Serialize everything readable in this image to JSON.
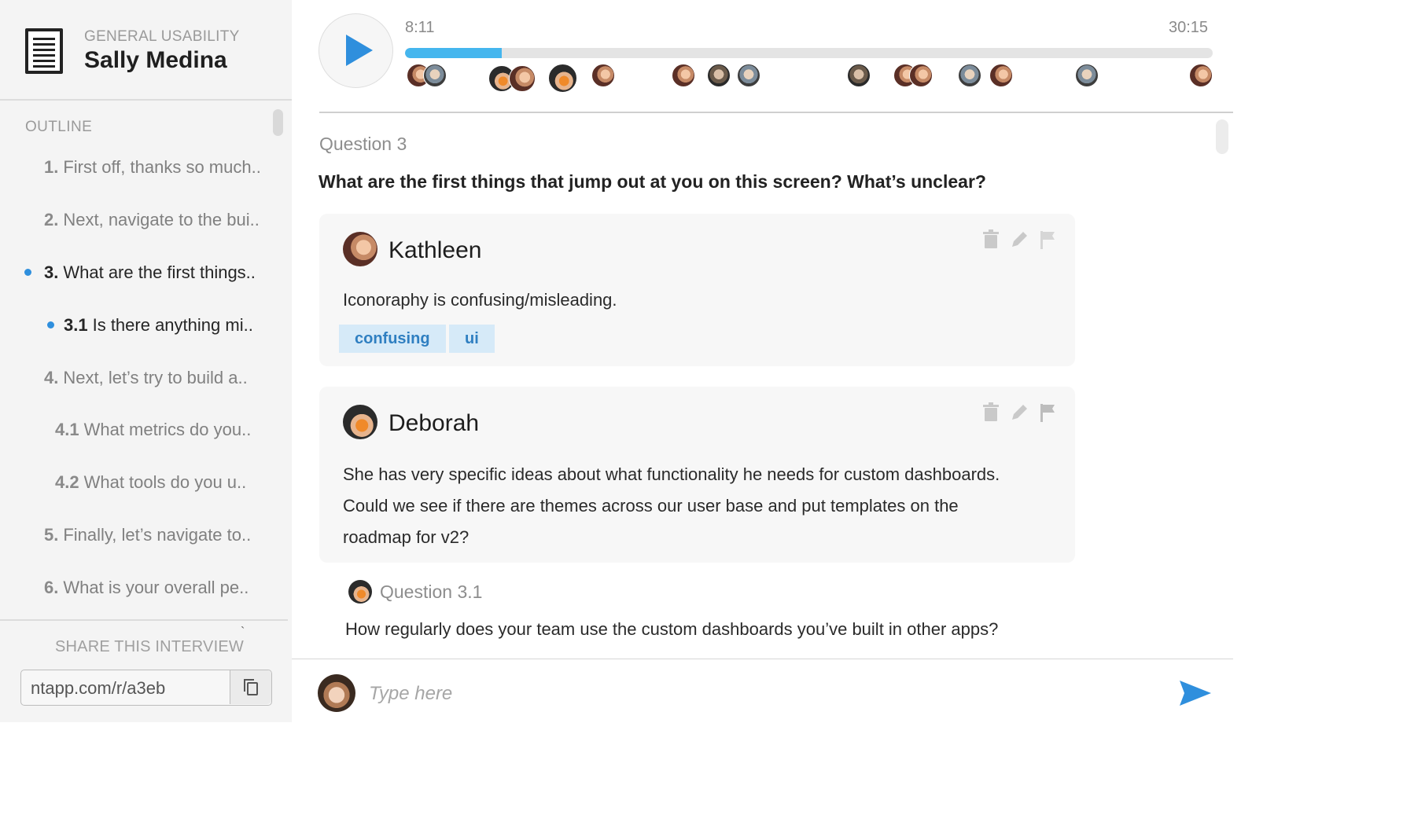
{
  "sidebar": {
    "eyebrow": "GENERAL USABILITY",
    "title": "Sally Medina",
    "outline_label": "OUTLINE",
    "items": [
      {
        "num": "1.",
        "label": "First off, thanks so much..",
        "active": false
      },
      {
        "num": "2.",
        "label": "Next, navigate to the bui..",
        "active": false
      },
      {
        "num": "3.",
        "label": "What are the first things..",
        "active": true
      },
      {
        "num": "3.1",
        "label": "Is there anything mi..",
        "active": true
      },
      {
        "num": "4.",
        "label": "Next, let’s try to build a..",
        "active": false
      },
      {
        "num": "4.1",
        "label": "What metrics do you..",
        "active": false
      },
      {
        "num": "4.2",
        "label": "What tools do you u..",
        "active": false
      },
      {
        "num": "5.",
        "label": "Finally, let’s navigate to..",
        "active": false
      },
      {
        "num": "6.",
        "label": "What is your overall pe..",
        "active": false
      }
    ],
    "tick_mark": "`",
    "share_label": "SHARE THIS INTERVIEW",
    "share_url": "ntapp.com/r/a3eb",
    "copy_icon": "copy-icon"
  },
  "player": {
    "current_time": "8:11",
    "total_time": "30:15",
    "progress": 0.12,
    "accent": "#45b6ee",
    "play_icon": "play-icon"
  },
  "question": {
    "label": "Question 3",
    "text": "What are the first things that jump out at you on this screen? What’s unclear?"
  },
  "notes": [
    {
      "author": "Kathleen",
      "text": "Iconoraphy is confusing/misleading.",
      "tags": [
        "confusing",
        "ui"
      ]
    },
    {
      "author": "Deborah",
      "text_lines": [
        "She has very specific ideas about what functionality he needs for custom dashboards.",
        "Could we see if there are themes across our user base and put templates on the",
        "roadmap for v2?"
      ]
    }
  ],
  "subquestion": {
    "label": "Question 3.1",
    "text": "How regularly does your team use the custom dashboards you’ve built in other apps?"
  },
  "composer": {
    "placeholder": "Type here",
    "send_icon": "send-icon",
    "send_color": "#2f8fdd"
  },
  "colors": {
    "accent": "#2f8fdd",
    "tag_bg": "#d6eaf8",
    "tag_text": "#2f7fc1"
  }
}
